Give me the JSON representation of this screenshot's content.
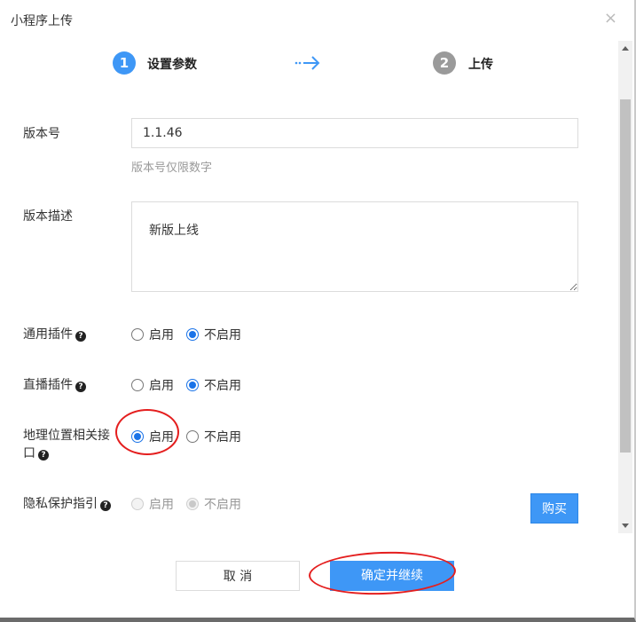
{
  "dialog": {
    "title": "小程序上传",
    "close_glyph": "×"
  },
  "steps": [
    {
      "number": "1",
      "label": "设置参数",
      "color": "#3e97f6"
    },
    {
      "number": "2",
      "label": "上传",
      "color": "#9a9a9a"
    }
  ],
  "form": {
    "version": {
      "label": "版本号",
      "value": "1.1.46",
      "hint": "版本号仅限数字"
    },
    "description": {
      "label": "版本描述",
      "value": "新版上线"
    },
    "general_plugin": {
      "label": "通用插件",
      "options": [
        "启用",
        "不启用"
      ],
      "selected": "不启用"
    },
    "live_plugin": {
      "label": "直播插件",
      "options": [
        "启用",
        "不启用"
      ],
      "selected": "不启用"
    },
    "geo_api": {
      "label_line1": "地理位置相关接",
      "label_line2": "口",
      "options": [
        "启用",
        "不启用"
      ],
      "selected": "启用"
    },
    "privacy": {
      "label": "隐私保护指引",
      "options": [
        "启用",
        "不启用"
      ],
      "selected": "不启用",
      "disabled": true,
      "buy_label": "购买"
    }
  },
  "footer": {
    "cancel_label": "取 消",
    "confirm_label": "确定并继续"
  },
  "icons": {
    "help": "help-icon",
    "close": "close-icon",
    "step_arrow": "dotted-arrow-right-icon"
  },
  "colors": {
    "accent": "#3e97f6",
    "annotation": "#e41e1e"
  }
}
